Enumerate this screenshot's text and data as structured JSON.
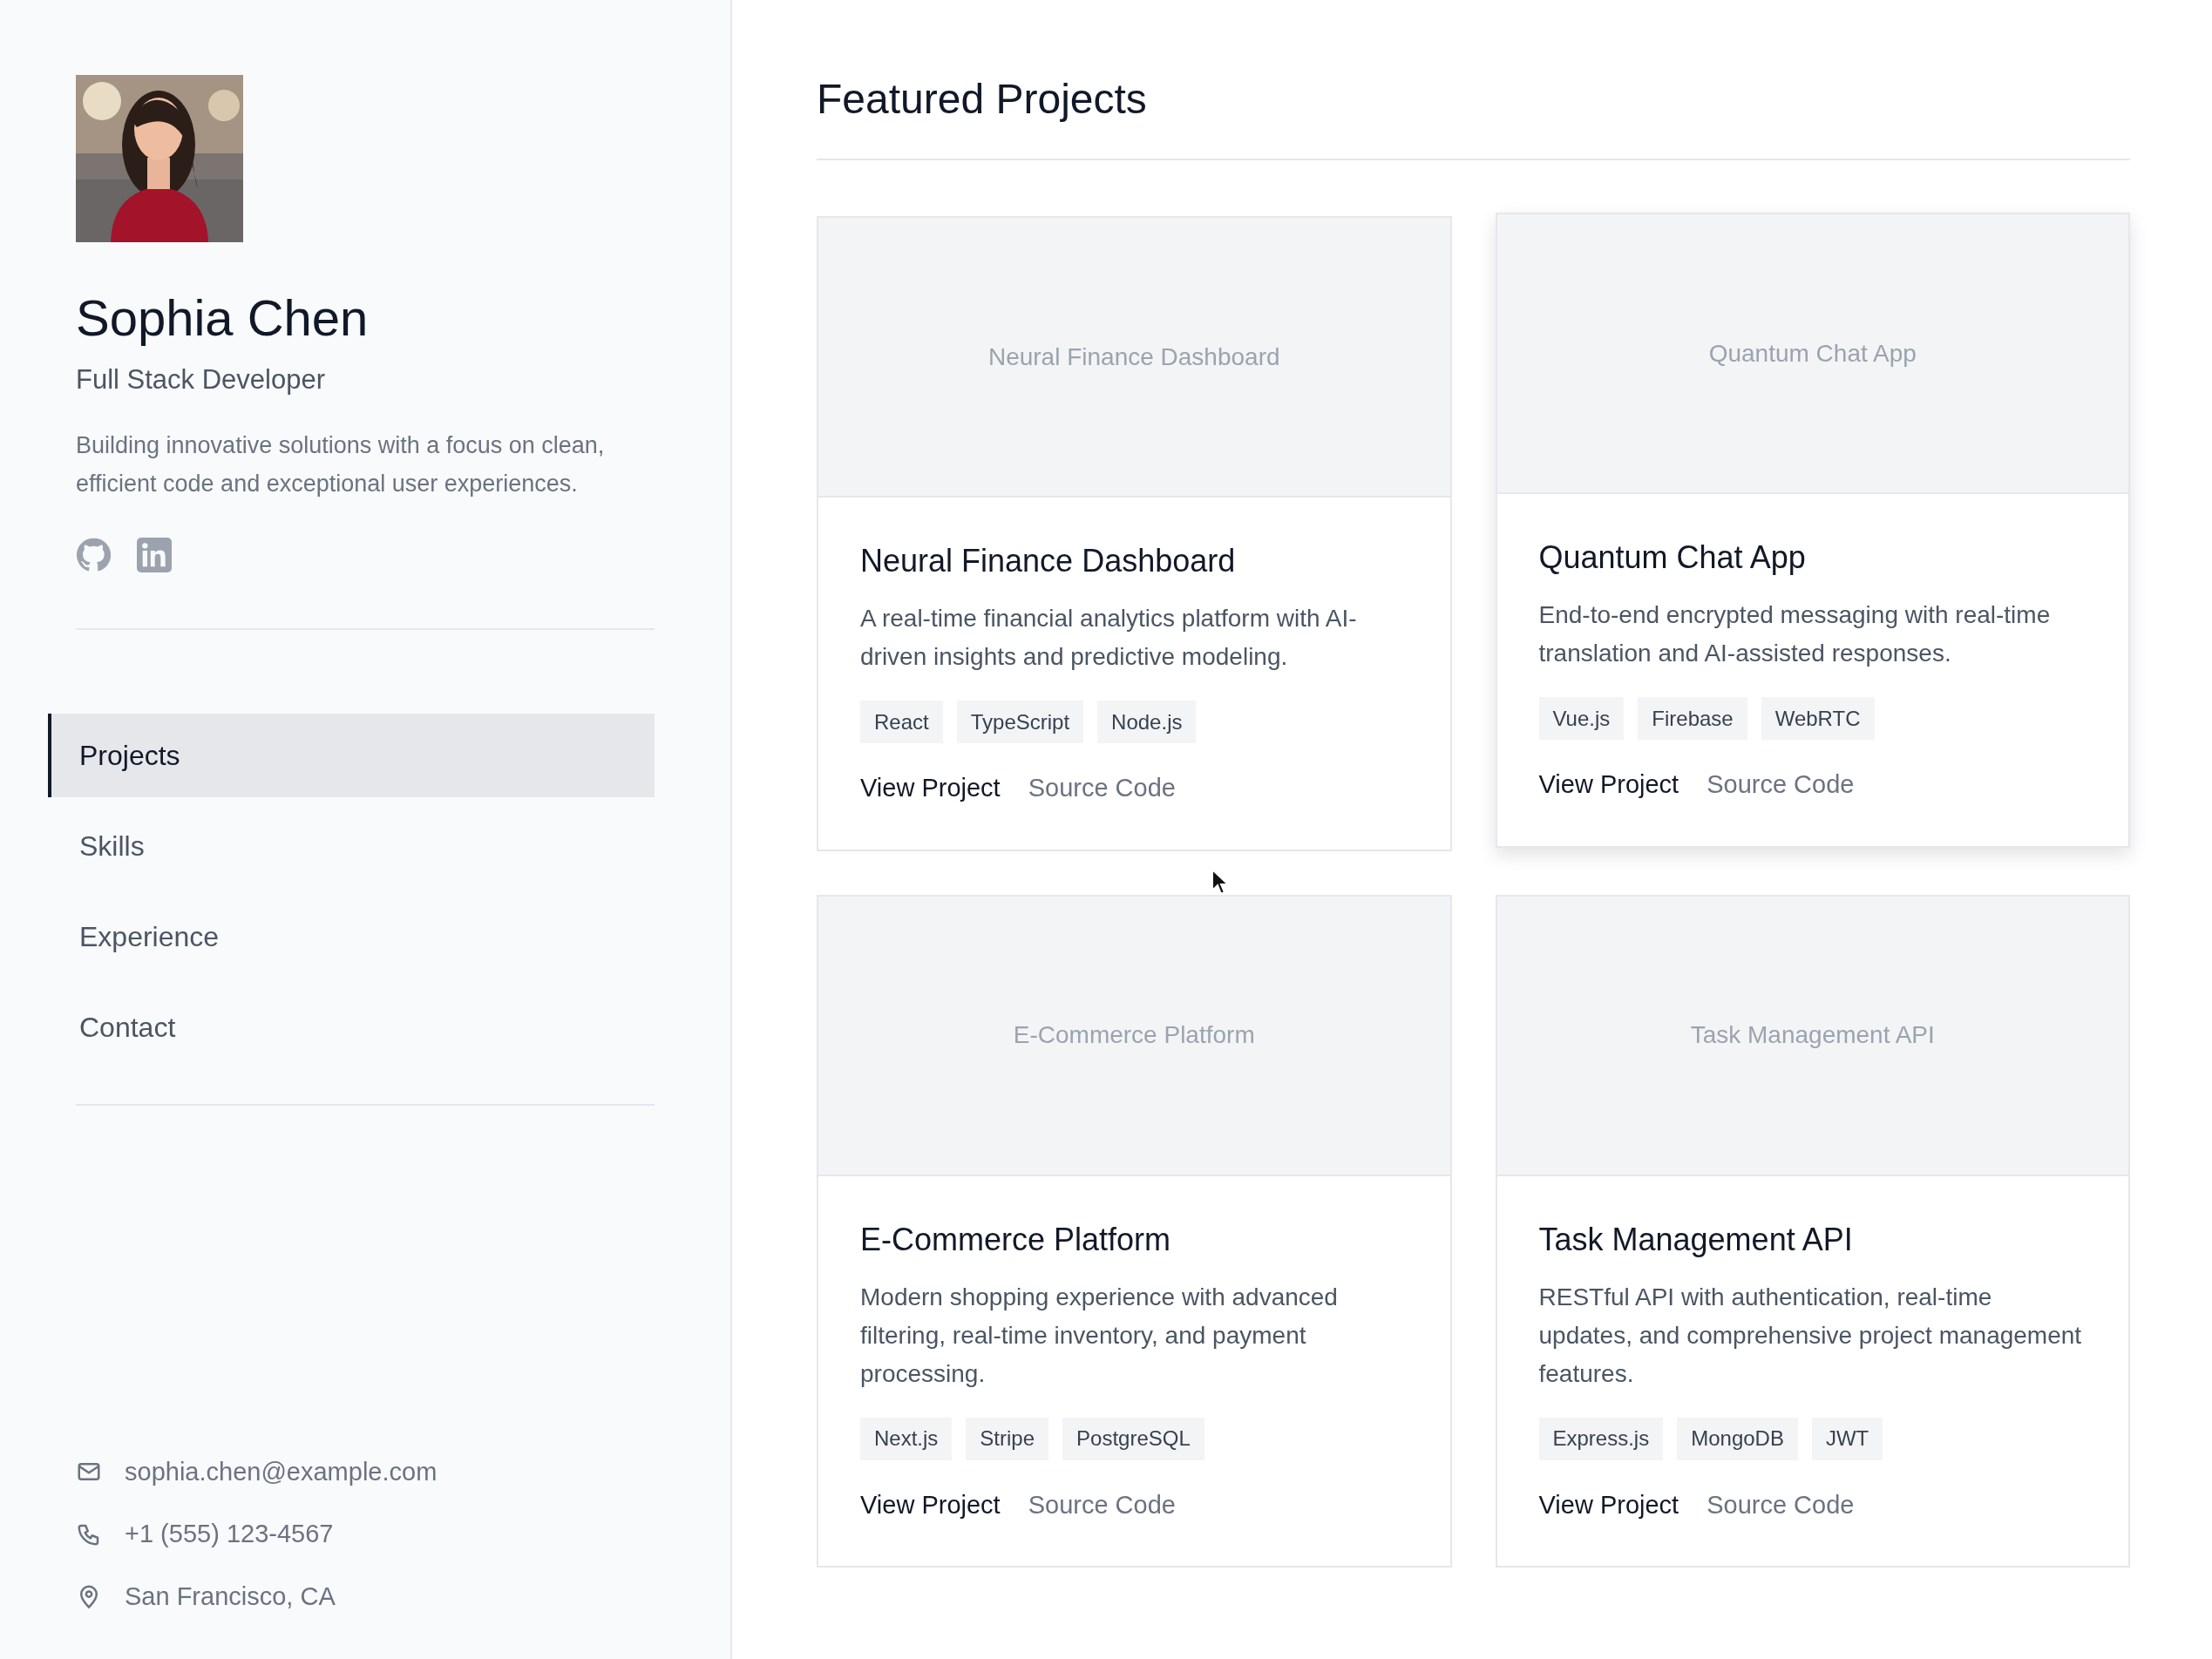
{
  "profile": {
    "name": "Sophia Chen",
    "role": "Full Stack Developer",
    "bio": "Building innovative solutions with a focus on clean, efficient code and exceptional user experiences.",
    "social": [
      {
        "kind": "github"
      },
      {
        "kind": "linkedin"
      }
    ]
  },
  "nav": [
    {
      "label": "Projects",
      "selected": true
    },
    {
      "label": "Skills",
      "selected": false
    },
    {
      "label": "Experience",
      "selected": false
    },
    {
      "label": "Contact",
      "selected": false
    }
  ],
  "contact": [
    {
      "kind": "email",
      "text": "sophia.chen@example.com"
    },
    {
      "kind": "phone",
      "text": "+1 (555) 123-4567"
    },
    {
      "kind": "location",
      "text": "San Francisco, CA"
    }
  ],
  "main": {
    "title": "Featured Projects",
    "projects": [
      {
        "image_label": "Neural Finance Dashboard",
        "title": "Neural Finance Dashboard",
        "description": "A real-time financial analytics platform with AI-driven insights and predictive modeling.",
        "tags": [
          "React",
          "TypeScript",
          "Node.js"
        ],
        "links": [
          "View Project",
          "Source Code"
        ],
        "hovered": false
      },
      {
        "image_label": "Quantum Chat App",
        "title": "Quantum Chat App",
        "description": "End-to-end encrypted messaging with real-time translation and AI-assisted responses.",
        "tags": [
          "Vue.js",
          "Firebase",
          "WebRTC"
        ],
        "links": [
          "View Project",
          "Source Code"
        ],
        "hovered": true
      },
      {
        "image_label": "E-Commerce Platform",
        "title": "E-Commerce Platform",
        "description": "Modern shopping experience with advanced filtering, real-time inventory, and payment processing.",
        "tags": [
          "Next.js",
          "Stripe",
          "PostgreSQL"
        ],
        "links": [
          "View Project",
          "Source Code"
        ],
        "hovered": false
      },
      {
        "image_label": "Task Management API",
        "title": "Task Management API",
        "description": "RESTful API with authentication, real-time updates, and comprehensive project management features.",
        "tags": [
          "Express.js",
          "MongoDB",
          "JWT"
        ],
        "links": [
          "View Project",
          "Source Code"
        ],
        "hovered": false
      }
    ]
  }
}
